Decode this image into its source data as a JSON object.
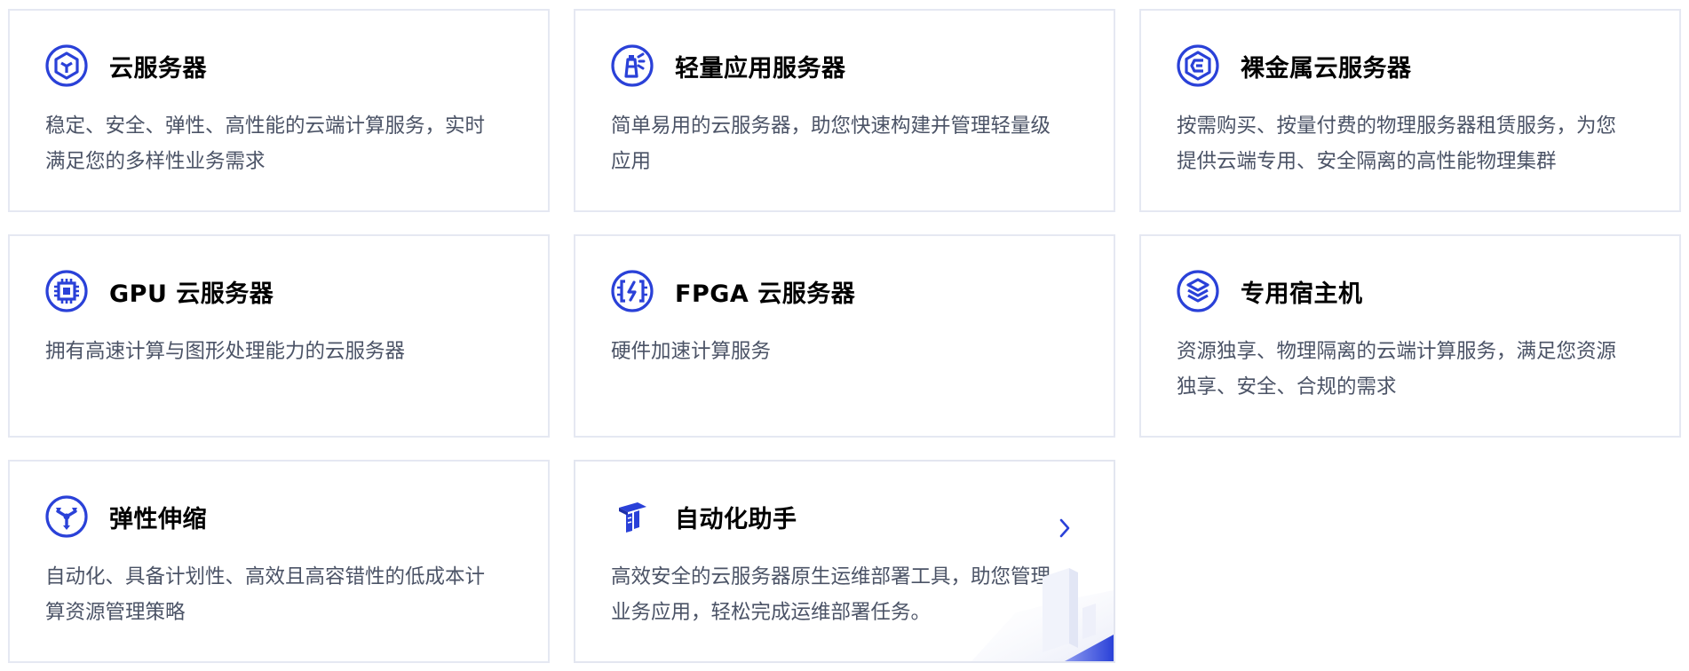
{
  "cards": [
    {
      "icon": "cloud-server-icon",
      "title": "云服务器",
      "desc": "稳定、安全、弹性、高性能的云端计算服务，实时满足您的多样性业务需求"
    },
    {
      "icon": "lighthouse-icon",
      "title": "轻量应用服务器",
      "desc": "简单易用的云服务器，助您快速构建并管理轻量级应用"
    },
    {
      "icon": "bare-metal-icon",
      "title": "裸金属云服务器",
      "desc": "按需购买、按量付费的物理服务器租赁服务，为您提供云端专用、安全隔离的高性能物理集群"
    },
    {
      "icon": "gpu-chip-icon",
      "title": "GPU 云服务器",
      "desc": "拥有高速计算与图形处理能力的云服务器"
    },
    {
      "icon": "fpga-icon",
      "title": "FPGA 云服务器",
      "desc": "硬件加速计算服务"
    },
    {
      "icon": "dedicated-host-icon",
      "title": "专用宿主机",
      "desc": "资源独享、物理隔离的云端计算服务，满足您资源独享、安全、合规的需求"
    },
    {
      "icon": "auto-scaling-icon",
      "title": "弹性伸缩",
      "desc": "自动化、具备计划性、高效且高容错性的低成本计算资源管理策略"
    },
    {
      "icon": "automation-assistant-icon",
      "title": "自动化助手",
      "desc": "高效安全的云服务器原生运维部署工具，助您管理业务应用，轻松完成运维部署任务。"
    }
  ],
  "colors": {
    "accent": "#2a41d8",
    "title": "#000000",
    "desc": "#4b5366",
    "border": "#e5e8f2"
  }
}
